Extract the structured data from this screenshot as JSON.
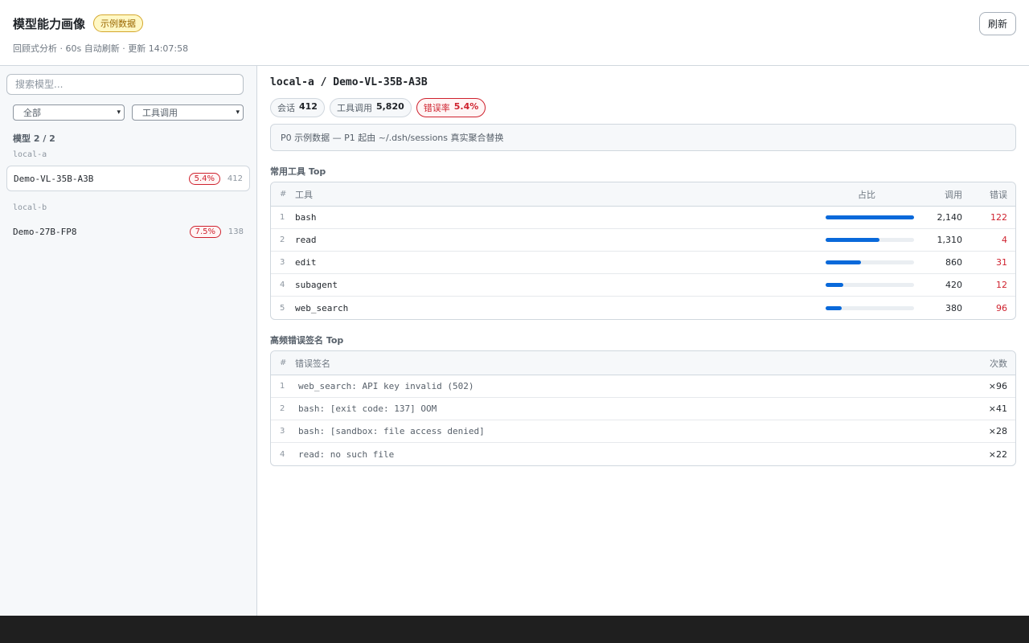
{
  "header": {
    "title": "模型能力画像",
    "badge": "示例数据",
    "subtitle": "回顾式分析 · 60s 自动刷新 · 更新 14:07:58",
    "refresh_label": "刷新"
  },
  "sidebar": {
    "search_placeholder": "搜索模型...",
    "filter_scope": "全部",
    "filter_type": "工具调用",
    "models_count_label": "模型 2 / 2",
    "groups": [
      {
        "label": "local-a",
        "models": [
          {
            "name": "Demo-VL-35B-A3B",
            "error_rate": "5.4%",
            "count": "412",
            "active": true
          }
        ]
      },
      {
        "label": "local-b",
        "models": [
          {
            "name": "Demo-27B-FP8",
            "error_rate": "7.5%",
            "count": "138",
            "active": false
          }
        ]
      }
    ]
  },
  "main": {
    "model_title": "local-a / Demo-VL-35B-A3B",
    "stats": {
      "sessions_label": "会话",
      "sessions_value": "412",
      "calls_label": "工具调用",
      "calls_value": "5,820",
      "error_label": "错误率",
      "error_value": "5.4%"
    },
    "notice": "P0 示例数据 — P1 起由 ~/.dsh/sessions 真实聚合替换",
    "tools_section": {
      "title": "常用工具 Top",
      "headers": {
        "idx": "#",
        "name": "工具",
        "share": "占比",
        "calls": "调用",
        "errors": "错误"
      },
      "rows": [
        {
          "idx": "1",
          "name": "bash",
          "share": 1.0,
          "calls": "2,140",
          "errors": "122"
        },
        {
          "idx": "2",
          "name": "read",
          "share": 0.612,
          "calls": "1,310",
          "errors": "4"
        },
        {
          "idx": "3",
          "name": "edit",
          "share": 0.402,
          "calls": "860",
          "errors": "31"
        },
        {
          "idx": "4",
          "name": "subagent",
          "share": 0.196,
          "calls": "420",
          "errors": "12"
        },
        {
          "idx": "5",
          "name": "web_search",
          "share": 0.178,
          "calls": "380",
          "errors": "96"
        }
      ]
    },
    "errors_section": {
      "title": "高频错误签名 Top",
      "headers": {
        "idx": "#",
        "signature": "错误签名",
        "times": "次数"
      },
      "rows": [
        {
          "idx": "1",
          "signature": "web_search: API key invalid (502)",
          "times": "×96"
        },
        {
          "idx": "2",
          "signature": "bash: [exit code: 137] OOM",
          "times": "×41"
        },
        {
          "idx": "3",
          "signature": "bash: [sandbox: file access denied]",
          "times": "×28"
        },
        {
          "idx": "4",
          "signature": "read: no such file",
          "times": "×22"
        }
      ]
    }
  },
  "colors": {
    "accent": "#0969da",
    "error": "#cf222e",
    "badge": "#9a6700"
  }
}
